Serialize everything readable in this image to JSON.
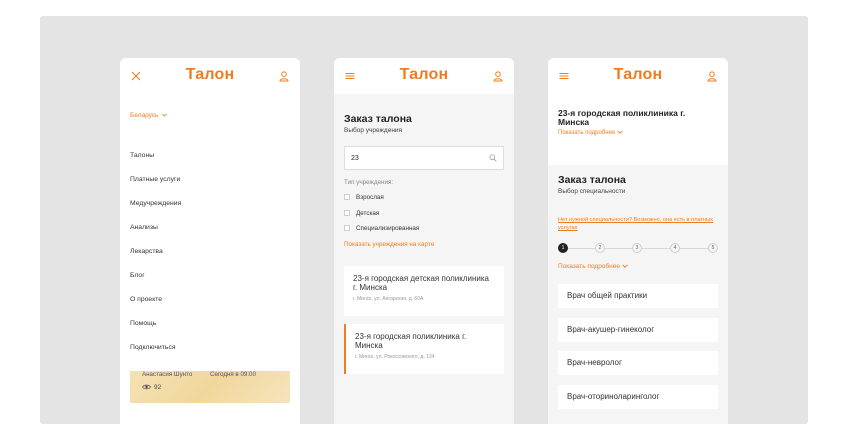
{
  "brand": {
    "logo": "Талон",
    "accent": "#f07c1e"
  },
  "phone1": {
    "country": "Беларусь",
    "menu": [
      "Талоны",
      "Платные услуги",
      "Медучреждения",
      "Анализы",
      "Лекарства",
      "Блог",
      "О проекте",
      "Помощь",
      "Подключиться"
    ],
    "card": {
      "author": "Анастасия Шунто",
      "date": "Сегодня в 09:00",
      "views": "92"
    }
  },
  "phone2": {
    "title": "Заказ талона",
    "subtitle": "Выбор учреждения",
    "search_value": "23",
    "filter_label": "Тип учреждения:",
    "filters": [
      "Взрослая",
      "Детская",
      "Специализированная"
    ],
    "map_link": "Показать учреждения на карте",
    "clinics": [
      {
        "name": "23-я городская детская поликлиника г. Минска",
        "address": "г. Минск, ул. Ангарская, д. 60А"
      },
      {
        "name": "23-я городская поликлиника г. Минска",
        "address": "г. Минск, ул. Рокоссовского, д. 134"
      }
    ]
  },
  "phone3": {
    "clinic_name": "23-я городская поликлиника г. Минска",
    "show_more": "Показать подробнее",
    "title": "Заказ талона",
    "subtitle": "Выбор специальности",
    "no_spec_link": "Нет нужной специальности? Возможно, она есть в платных услугах",
    "steps": [
      "1",
      "2",
      "3",
      "4",
      "5"
    ],
    "show_more2": "Показать подробнее",
    "specialties": [
      "Врач общей практики",
      "Врач-акушер-гинеколог",
      "Врач-невролог",
      "Врач-оториноларинголог"
    ]
  }
}
